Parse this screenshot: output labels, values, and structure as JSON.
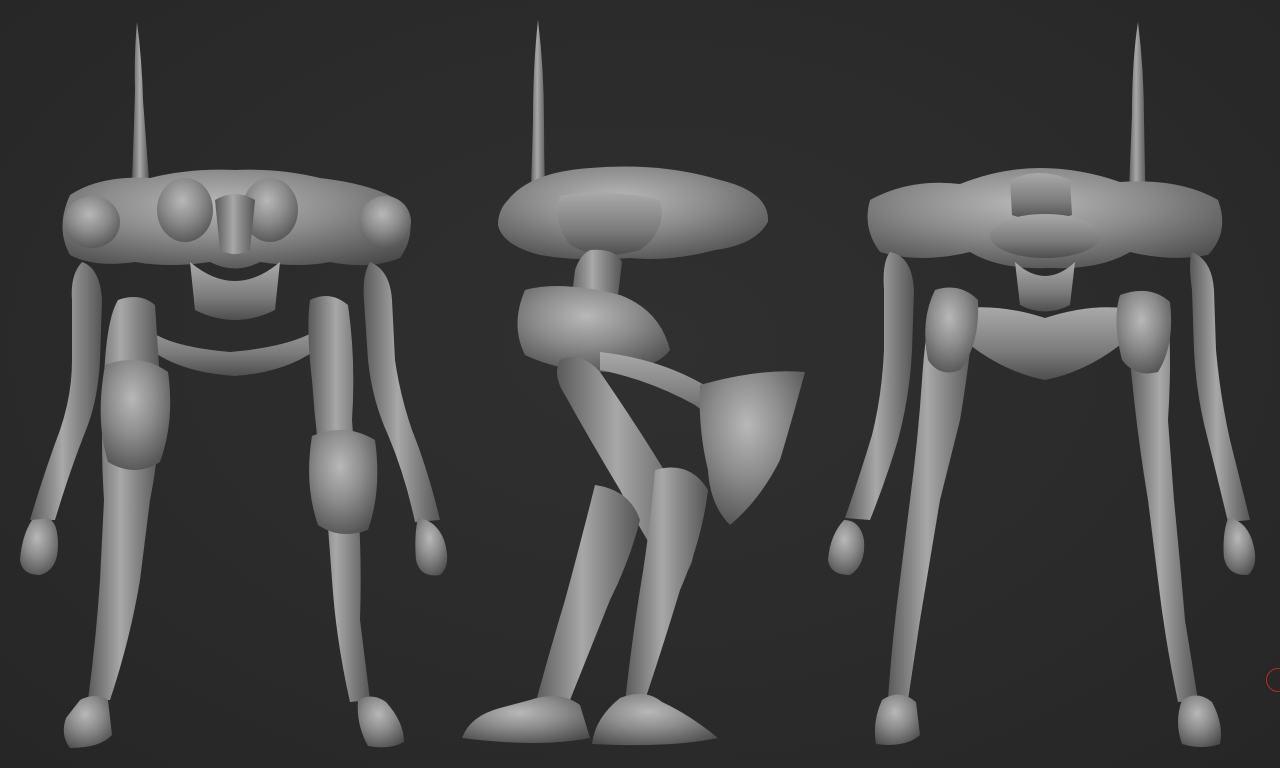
{
  "scene": {
    "background_color": "#2b2b2b",
    "model_color": "#8a8a8a",
    "model_shadow_color": "#4d4d4d",
    "model_highlight_color": "#b5b5b5",
    "marker_color": "#b32a2a",
    "views": [
      {
        "id": "front",
        "label": ""
      },
      {
        "id": "side",
        "label": ""
      },
      {
        "id": "back",
        "label": ""
      }
    ]
  }
}
